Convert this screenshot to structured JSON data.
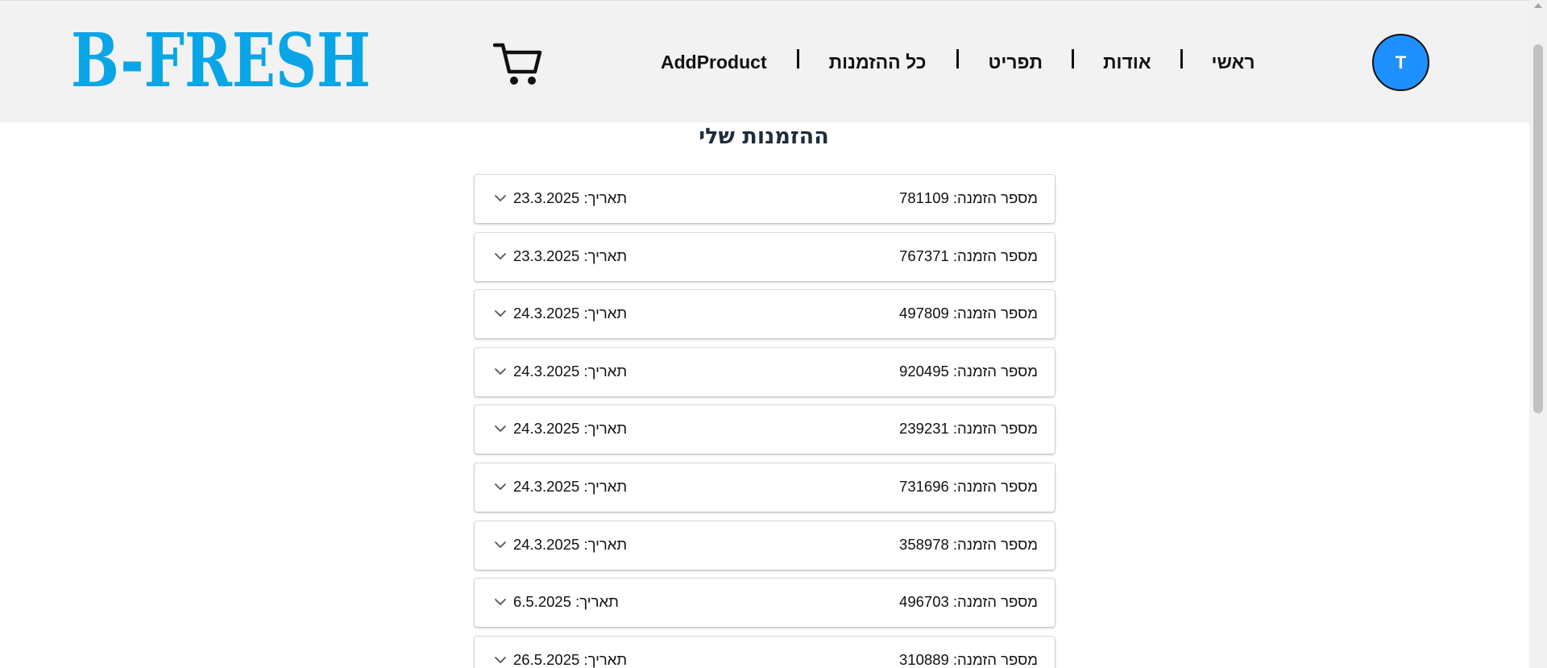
{
  "header": {
    "logo_text": "B-FRESH",
    "colors": {
      "logo": "#0aa5e6",
      "avatar": "#1e90ff",
      "header_bg": "#f2f2f2"
    },
    "cart_icon": "shopping-cart-icon",
    "nav": {
      "home": "ראשי",
      "about": "אודות",
      "menu": "תפריט",
      "all_orders": "כל ההזמנות",
      "add_product": "AddProduct"
    },
    "avatar_initial": "T"
  },
  "main": {
    "title": "ההזמנות שלי",
    "order_label": "מספר הזמנה:",
    "date_label": "תאריך:",
    "expand_icon": "chevron-down-icon",
    "orders": [
      {
        "number": "781109",
        "date": "23.3.2025"
      },
      {
        "number": "767371",
        "date": "23.3.2025"
      },
      {
        "number": "497809",
        "date": "24.3.2025"
      },
      {
        "number": "920495",
        "date": "24.3.2025"
      },
      {
        "number": "239231",
        "date": "24.3.2025"
      },
      {
        "number": "731696",
        "date": "24.3.2025"
      },
      {
        "number": "358978",
        "date": "24.3.2025"
      },
      {
        "number": "496703",
        "date": "6.5.2025"
      },
      {
        "number": "310889",
        "date": "26.5.2025"
      }
    ]
  }
}
